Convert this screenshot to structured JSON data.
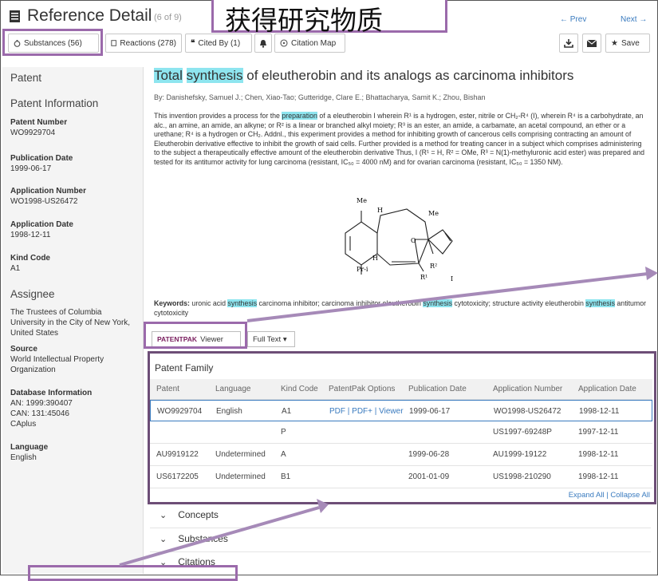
{
  "header": {
    "title": "Reference Detail",
    "subtitle": "(6 of 9)",
    "prev": "← Prev",
    "next": "Next →",
    "callout": "获得研究物质"
  },
  "toolbar": {
    "substances": "Substances (56)",
    "reactions": "Reactions (278)",
    "cited_by": "Cited By (1)",
    "citation_map": "Citation Map",
    "save": "Save"
  },
  "sidebar": {
    "patent": "Patent",
    "patent_info": "Patent Information",
    "patent_number_label": "Patent Number",
    "patent_number": "WO9929704",
    "pub_date_label": "Publication Date",
    "pub_date": "1999-06-17",
    "app_number_label": "Application Number",
    "app_number": "WO1998-US26472",
    "app_date_label": "Application Date",
    "app_date": "1998-12-11",
    "kind_label": "Kind Code",
    "kind": "A1",
    "assignee_head": "Assignee",
    "assignee_l1": "The Trustees of Columbia",
    "assignee_l2": "University in the City of New York,",
    "assignee_l3": "United States",
    "source_label": "Source",
    "source_l1": "World Intellectual Property",
    "source_l2": "Organization",
    "db_label": "Database Information",
    "db_an": "AN: 1999:390407",
    "db_can": "CAN: 131:45046",
    "db_caplus": "CAplus",
    "lang_label": "Language",
    "lang": "English"
  },
  "article": {
    "title_a": "Total",
    "title_b": "synthesis",
    "title_c": "of eleutherobin and its analogs as carcinoma inhibitors",
    "authors": "By: Danishefsky, Samuel J.; Chen, Xiao-Tao; Gutteridge, Clare E.; Bhattacharya, Samit K.; Zhou, Bishan",
    "abs_1": "This invention provides a process for the ",
    "abs_hl": "preparation",
    "abs_2": " of a eleutherobin I wherein R¹ is a hydrogen, ester, nitrile or CH₂-R⁴ (I), wherein R⁴ is a carbohydrate, an alc., an amine, an amide, an alkyne; or R² is a linear or branched alkyl moiety; R³ is an ester, an amide, a carbamate, an acetal compound, an ether or a urethane; R⁴ is a hydrogen or CH₂. Addnl., this experiment provides a method for inhibiting growth of cancerous cells comprising contracting an amount of Eleutherobin derivative effective to inhibit the growth of said cells. Further provided is a method for treating cancer in a subject which comprises administering to the subject a therapeutically effective amount of the eleutherobin derivative Thus, I (R¹ = H, R² = OMe, R³ = N(1)-methyluronic acid ester) was prepared and tested for its antitumor activity for lung carcinoma (resistant, IC₅₀ = 4000 nM) and for ovarian carcinoma (resistant, IC₅₀ = 1350 NM).",
    "struct": {
      "me1": "Me",
      "me2": "Me",
      "h1": "H",
      "h2": "H",
      "o": "O",
      "pri": "Pr-i",
      "r1": "R¹",
      "r2": "R²",
      "label": "I"
    },
    "kw_label": "Keywords:",
    "kw_1": " uronic acid ",
    "kw_hl": "synthesis",
    "kw_2": " carcinoma inhibitor; carcinoma inhibitor eleutherobin ",
    "kw_3": " cytotoxicity; structure activity eleutherobin ",
    "kw_4": " antitumor cytotoxicity",
    "patentpak": "PATENTPAK",
    "viewer": "Viewer",
    "fulltext": "Full Text ▾"
  },
  "family": {
    "title": "Patent Family",
    "headers": [
      "Patent",
      "Language",
      "Kind Code",
      "PatentPak Options",
      "Publication Date",
      "Application Number",
      "Application Date"
    ],
    "rows": [
      [
        "WO9929704",
        "English",
        "A1",
        "PDF | PDF+ | Viewer",
        "1999-06-17",
        "WO1998-US26472",
        "1998-12-11"
      ],
      [
        "",
        "",
        "P",
        "",
        "",
        "US1997-69248P",
        "1997-12-11"
      ],
      [
        "AU9919122",
        "Undetermined",
        "A",
        "",
        "1999-06-28",
        "AU1999-19122",
        "1998-12-11"
      ],
      [
        "US6172205",
        "Undetermined",
        "B1",
        "",
        "2001-01-09",
        "US1998-210290",
        "1998-12-11"
      ]
    ],
    "expand": "Expand All | Collapse All"
  },
  "sections": [
    "Concepts",
    "Substances",
    "Citations"
  ],
  "colors": {
    "highlight": "#8ee5ef",
    "callout_border": "#9b6aab",
    "link": "#3a7bbf"
  }
}
